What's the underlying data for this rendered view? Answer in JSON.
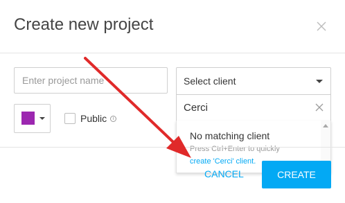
{
  "dialog": {
    "title": "Create new project"
  },
  "form": {
    "project_name": {
      "placeholder": "Enter project name",
      "value": ""
    },
    "client_select": {
      "label": "Select client"
    },
    "client_search": {
      "value": "Cerci"
    },
    "color": {
      "selected": "#9c27b0"
    },
    "public": {
      "label": "Public",
      "info": "i",
      "checked": false
    }
  },
  "client_dropdown": {
    "no_match": "No matching client",
    "hint": "Press Ctrl+Enter to quickly",
    "create_link": "create 'Cerci' client."
  },
  "footer": {
    "cancel_label": "Cancel",
    "create_label": "CREATE"
  },
  "colors": {
    "accent": "#03a9f4",
    "swatch": "#9c27b0",
    "annotation_arrow": "#e02a2a"
  },
  "icons": {
    "close": "close-icon",
    "clear": "clear-icon",
    "info": "info-icon",
    "caret": "chevron-down-icon",
    "annotation": "red-arrow-icon"
  }
}
